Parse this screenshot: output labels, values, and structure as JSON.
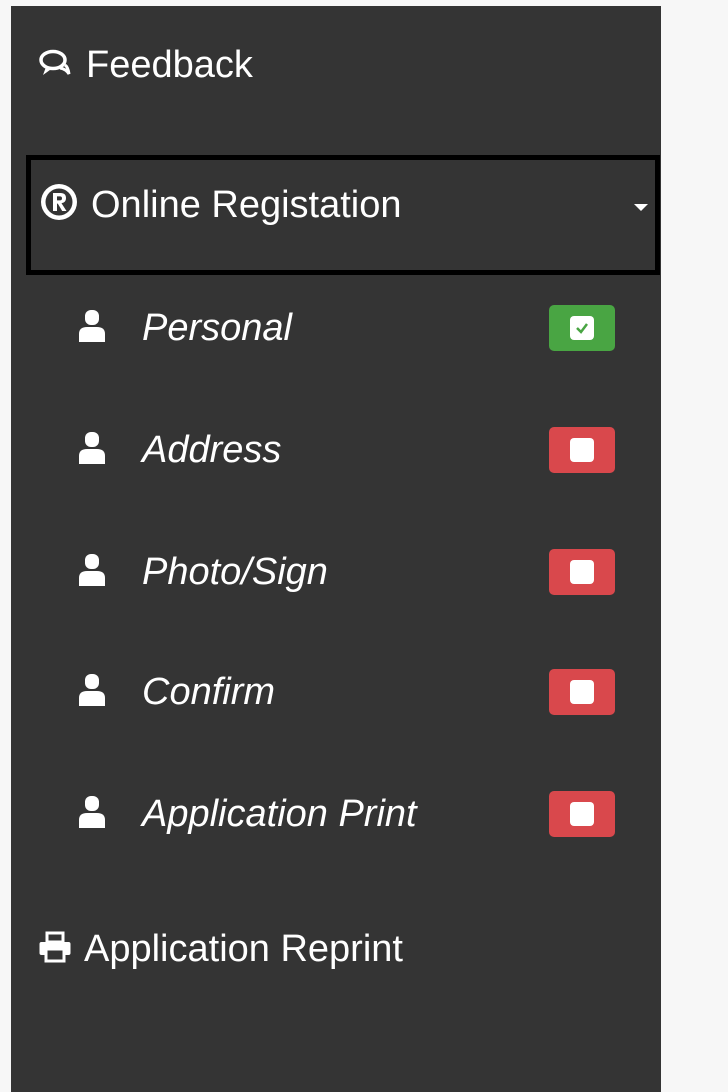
{
  "sidebar": {
    "feedback": {
      "label": "Feedback",
      "icon": "chat-bubbles-icon"
    },
    "registration": {
      "label": "Online Registation",
      "icon": "registered-icon",
      "caret": "caret-down-icon"
    },
    "steps": [
      {
        "label": "Personal",
        "icon": "user-icon",
        "status": "completed",
        "status_color": "#49a543"
      },
      {
        "label": "Address",
        "icon": "user-icon",
        "status": "pending",
        "status_color": "#d9484c"
      },
      {
        "label": "Photo/Sign",
        "icon": "user-icon",
        "status": "pending",
        "status_color": "#d9484c"
      },
      {
        "label": "Confirm",
        "icon": "user-icon",
        "status": "pending",
        "status_color": "#d9484c"
      },
      {
        "label": "Application Print",
        "icon": "user-icon",
        "status": "pending",
        "status_color": "#d9484c"
      }
    ],
    "reprint": {
      "label": "Application Reprint",
      "icon": "printer-icon"
    }
  },
  "colors": {
    "sidebar_bg": "#343434",
    "page_bg": "#f7f7f7",
    "completed": "#49a543",
    "pending": "#d9484c"
  }
}
